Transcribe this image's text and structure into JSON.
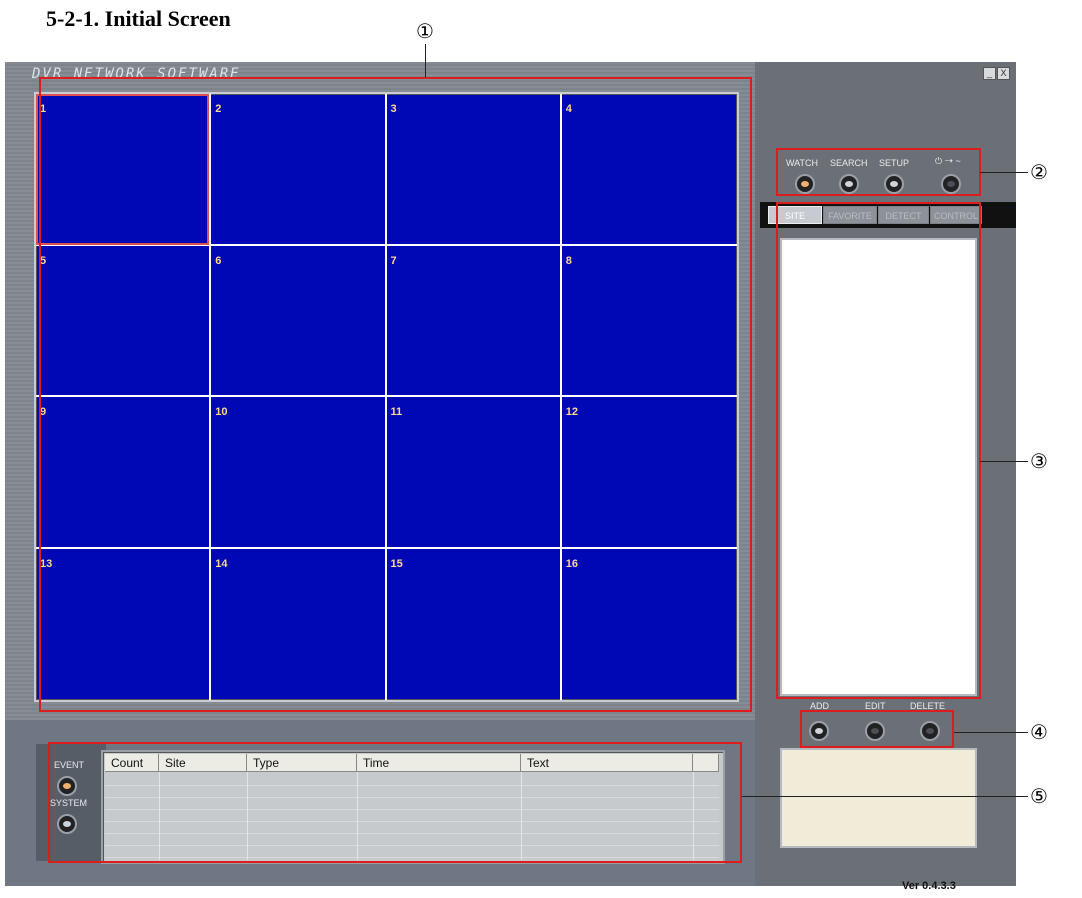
{
  "heading": "5-2-1. Initial Screen",
  "app_title": "DVR NETWORK SOFTWARE",
  "window_controls": {
    "minimize": "_",
    "close": "X"
  },
  "grid": {
    "cells": [
      "1",
      "2",
      "3",
      "4",
      "5",
      "6",
      "7",
      "8",
      "9",
      "10",
      "11",
      "12",
      "13",
      "14",
      "15",
      "16"
    ]
  },
  "top_buttons": {
    "watch": "WATCH",
    "search": "SEARCH",
    "setup": "SETUP",
    "exit": "⏻ ➝ ~"
  },
  "tabs": {
    "site": "SITE",
    "favorite": "FAVORITE",
    "detect": "DETECT",
    "control": "CONTROL"
  },
  "action_buttons": {
    "add": "ADD",
    "edit": "EDIT",
    "delete": "DELETE"
  },
  "event_panel": {
    "event": "EVENT",
    "system": "SYSTEM"
  },
  "table": {
    "headers": [
      "Count",
      "Site",
      "Type",
      "Time",
      "Text"
    ]
  },
  "version": "Ver 0.4.3.3",
  "callouts": {
    "c1": "①",
    "c2": "②",
    "c3": "③",
    "c4": "④",
    "c5": "⑤"
  },
  "colors": {
    "grid_blue": "#0007b5",
    "callout_red": "#dd1d1d",
    "window_grey": "#6b7480"
  }
}
